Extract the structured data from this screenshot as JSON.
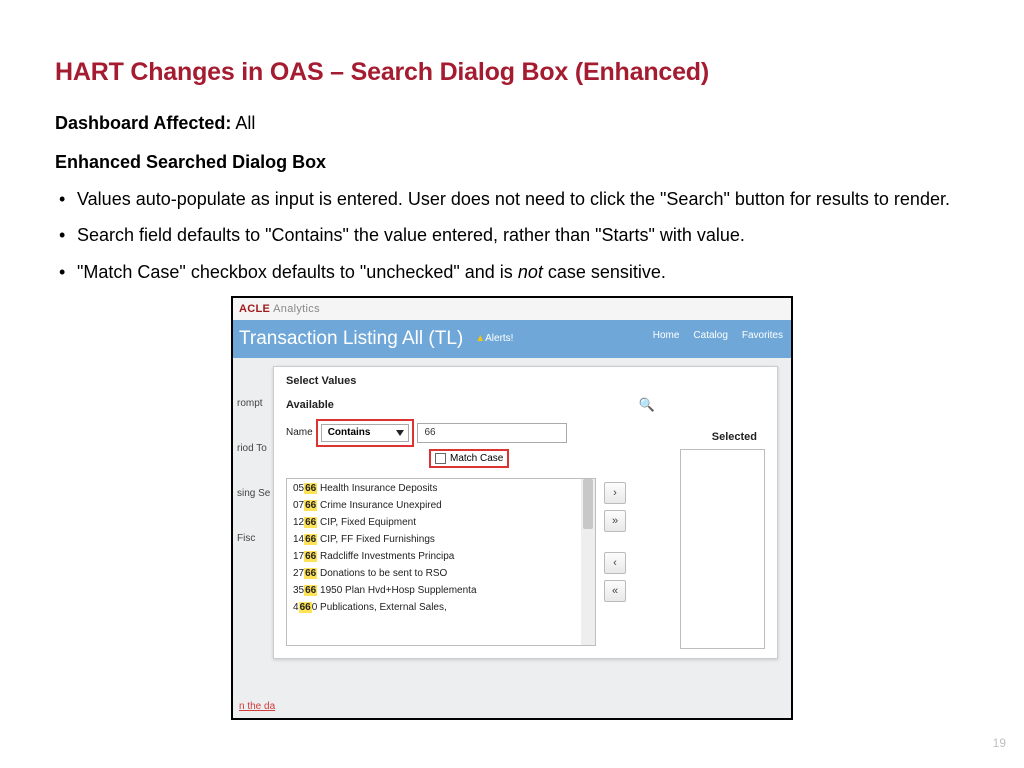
{
  "title": "HART Changes in OAS – Search Dialog Box (Enhanced)",
  "dashboard_label": "Dashboard Affected:",
  "dashboard_value": "All",
  "subheading": "Enhanced Searched Dialog Box",
  "bullets": {
    "b1": "Values auto-populate as input is entered. User does not need to click the \"Search\" button for results to render.",
    "b2": "Search field defaults to \"Contains\" the value entered, rather than \"Starts\" with value.",
    "b3a": "\"Match Case\" checkbox defaults to \"unchecked\" and is ",
    "b3not": "not",
    "b3b": " case sensitive."
  },
  "screenshot": {
    "brand_a": "ACLE",
    "brand_suffix": " Analytics",
    "page_title": "Transaction Listing All (TL)",
    "nav": {
      "alerts": "Alerts!",
      "home": "Home",
      "catalog": "Catalog",
      "favorites": "Favorites"
    },
    "dialog_title": "Select Values",
    "available": "Available",
    "selected": "Selected",
    "name_label": "Name",
    "contains_label": "Contains",
    "search_value": "66",
    "match_case": "Match Case",
    "left": {
      "l1": "rompt",
      "l2": "riod To",
      "l3": "sing Se",
      "l4": "Fisc"
    },
    "redlink": "n the da",
    "buttons": {
      "r": "›",
      "rr": "»",
      "l": "‹",
      "ll": "«"
    },
    "results": [
      {
        "pre": "05",
        "hl": "66",
        "post": " Health Insurance Deposits"
      },
      {
        "pre": "07",
        "hl": "66",
        "post": " Crime Insurance Unexpired"
      },
      {
        "pre": "12",
        "hl": "66",
        "post": " CIP, Fixed Equipment"
      },
      {
        "pre": "14",
        "hl": "66",
        "post": " CIP, FF Fixed Furnishings"
      },
      {
        "pre": "17",
        "hl": "66",
        "post": " Radcliffe Investments Principa"
      },
      {
        "pre": "27",
        "hl": "66",
        "post": " Donations to be sent to RSO"
      },
      {
        "pre": "35",
        "hl": "66",
        "post": " 1950 Plan Hvd+Hosp Supplementa"
      },
      {
        "pre": "4",
        "hl": "66",
        "post": "0 Publications, External Sales,"
      }
    ]
  },
  "page_number": "19"
}
